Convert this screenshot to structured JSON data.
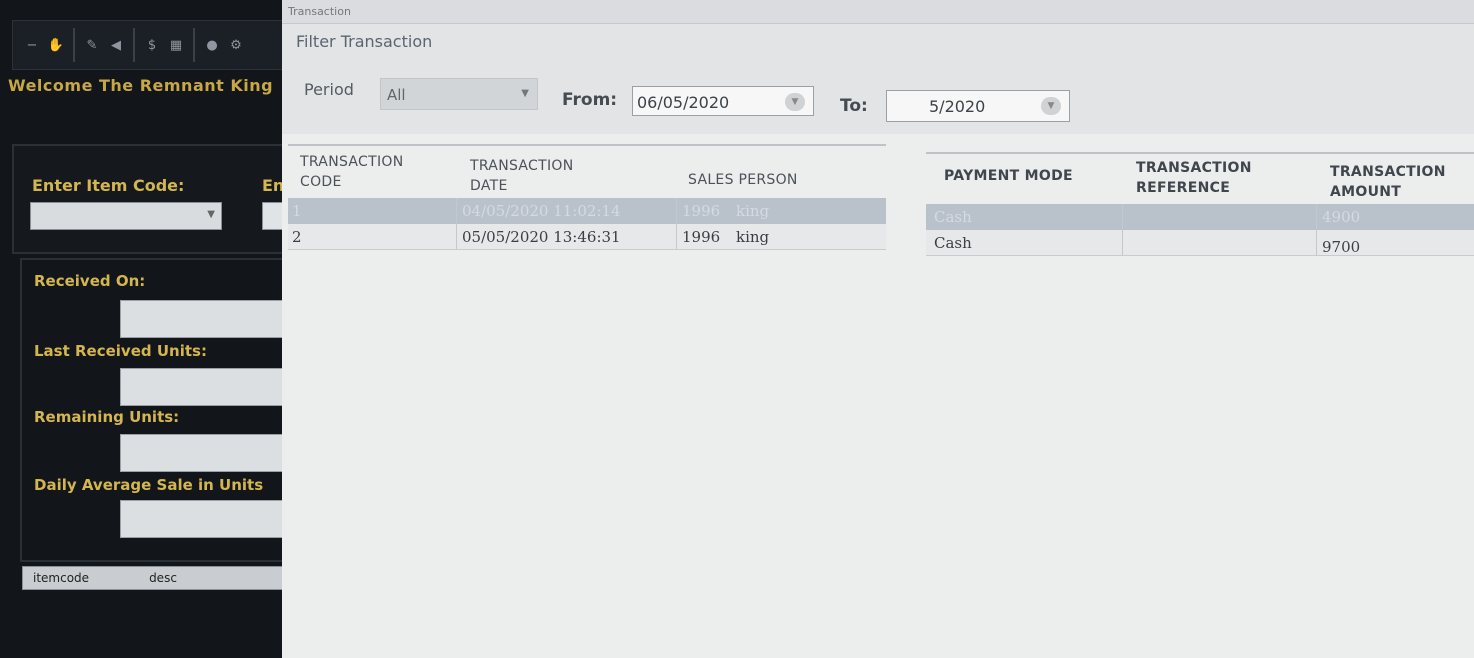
{
  "main": {
    "welcome_text": "Welcome The Remnant King",
    "item_code_label": "Enter Item Code:",
    "item_code_label_2": "En",
    "stock": {
      "received_on": "Received On:",
      "last_received_units": "Last Received Units:",
      "remaining_units": "Remaining Units:",
      "daily_average_sale": "Daily Average Sale in Units"
    },
    "item_grid": {
      "col_itemcode": "itemcode",
      "col_desc": "desc"
    }
  },
  "dialog": {
    "title": "Transaction",
    "filter": {
      "legend": "Filter Transaction",
      "period_label": "Period",
      "period_value": "All",
      "from_label": "From:",
      "from_value": "06/05/2020",
      "to_label": "To:",
      "to_value": "5/2020"
    },
    "left_headers": {
      "code_1": "TRANSACTION",
      "code_2": "CODE",
      "date_1": "TRANSACTION",
      "date_2": "DATE",
      "sales": "SALES PERSON"
    },
    "right_headers": {
      "payment": "PAYMENT MODE",
      "ref_1": "TRANSACTION",
      "ref_2": "REFERENCE",
      "amt_1": "TRANSACTION",
      "amt_2": "AMOUNT"
    },
    "rows": [
      {
        "code": "1",
        "date": "04/05/2020 11:02:14",
        "sales_id": "1996",
        "sales_name": "king",
        "payment": "Cash",
        "reference": "",
        "amount": "4900"
      },
      {
        "code": "2",
        "date": "05/05/2020 13:46:31",
        "sales_id": "1996",
        "sales_name": "king",
        "payment": "Cash",
        "reference": "",
        "amount": "9700"
      }
    ]
  }
}
